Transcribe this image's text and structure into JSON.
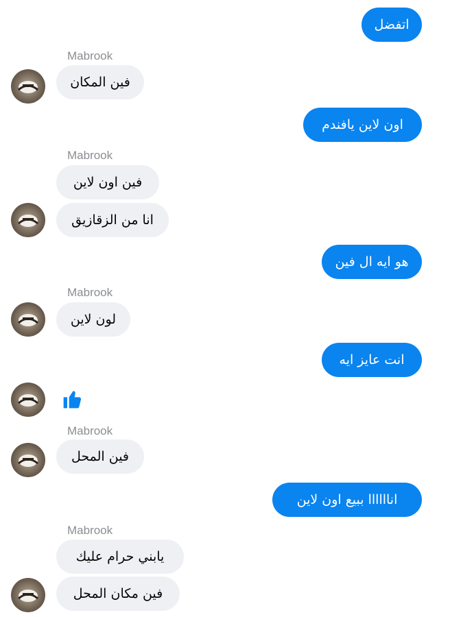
{
  "chat": {
    "messages": [
      {
        "text": "اتفضل"
      },
      {
        "sender": "Mabrook",
        "text": "فين المكان"
      },
      {
        "text": "اون لاين يافندم"
      },
      {
        "sender": "Mabrook",
        "text": "فين اون لاين"
      },
      {
        "text": "انا من الزقازيق"
      },
      {
        "text": "هو ايه ال فين"
      },
      {
        "sender": "Mabrook",
        "text": "لون لاين"
      },
      {
        "text": "انت عايز ايه"
      },
      {
        "reaction_icon": "thumbs-up-icon"
      },
      {
        "sender": "Mabrook",
        "text": "فين المحل"
      },
      {
        "text": "اناااااا ببيع اون لاين"
      },
      {
        "sender": "Mabrook",
        "text": "يابني حرام عليك"
      },
      {
        "text": "فين مكان المحل"
      }
    ]
  },
  "colors": {
    "outgoing_bubble": "#0a84ef",
    "incoming_bubble": "#eef0f4",
    "sender_name": "#8a8d91",
    "like_icon": "#0a84ef"
  }
}
